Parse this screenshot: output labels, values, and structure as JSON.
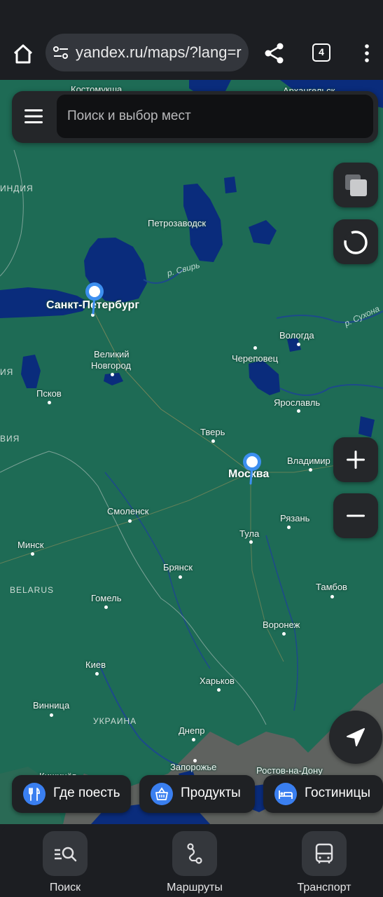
{
  "browser": {
    "url": "yandex.ru/maps/?lang=r",
    "tab_count": "4",
    "icons": {
      "home": "home-icon",
      "site_settings": "tune-icon",
      "share": "share-icon",
      "menu": "more-vert-icon"
    }
  },
  "search": {
    "placeholder": "Поиск и выбор мест"
  },
  "map": {
    "big_cities": [
      "Санкт-Петербург",
      "Москва"
    ],
    "cities": [
      "Костомукша",
      "Архангельск",
      "Петрозаводск",
      "Великий",
      "Новгород",
      "Вологда",
      "Череповец",
      "Псков",
      "Ярославль",
      "Тверь",
      "Владимир",
      "Смоленск",
      "Рязань",
      "Тула",
      "Минск",
      "Брянск",
      "Тамбов",
      "Гомель",
      "Воронеж",
      "Киев",
      "Харьков",
      "Винница",
      "Днепр",
      "Запорожье",
      "Кишинёв",
      "Ростов-на-Дону"
    ],
    "countries": [
      "ИНДИЯ",
      "ИЯ",
      "ВИЯ",
      "BELARUS",
      "УКРАИНА"
    ],
    "rivers": [
      "р. Свирь",
      "р. Сухона"
    ],
    "colors": {
      "land_ru": "#1e6b55",
      "land_outside": "#5f625f",
      "water": "#0a2c7c",
      "pin": "#3d8ff0"
    }
  },
  "controls": {
    "layers": "layers-icon",
    "compass": "compass-icon",
    "zoom_in": "plus-icon",
    "zoom_out": "minus-icon",
    "locate": "navigation-arrow-icon"
  },
  "chips": [
    {
      "label": "Где поесть",
      "icon": "fork-knife-icon"
    },
    {
      "label": "Продукты",
      "icon": "basket-icon"
    },
    {
      "label": "Гостиницы",
      "icon": "bed-icon"
    }
  ],
  "nav": [
    {
      "label": "Поиск",
      "icon": "search-list-icon"
    },
    {
      "label": "Маршруты",
      "icon": "route-icon"
    },
    {
      "label": "Транспорт",
      "icon": "bus-icon"
    }
  ]
}
